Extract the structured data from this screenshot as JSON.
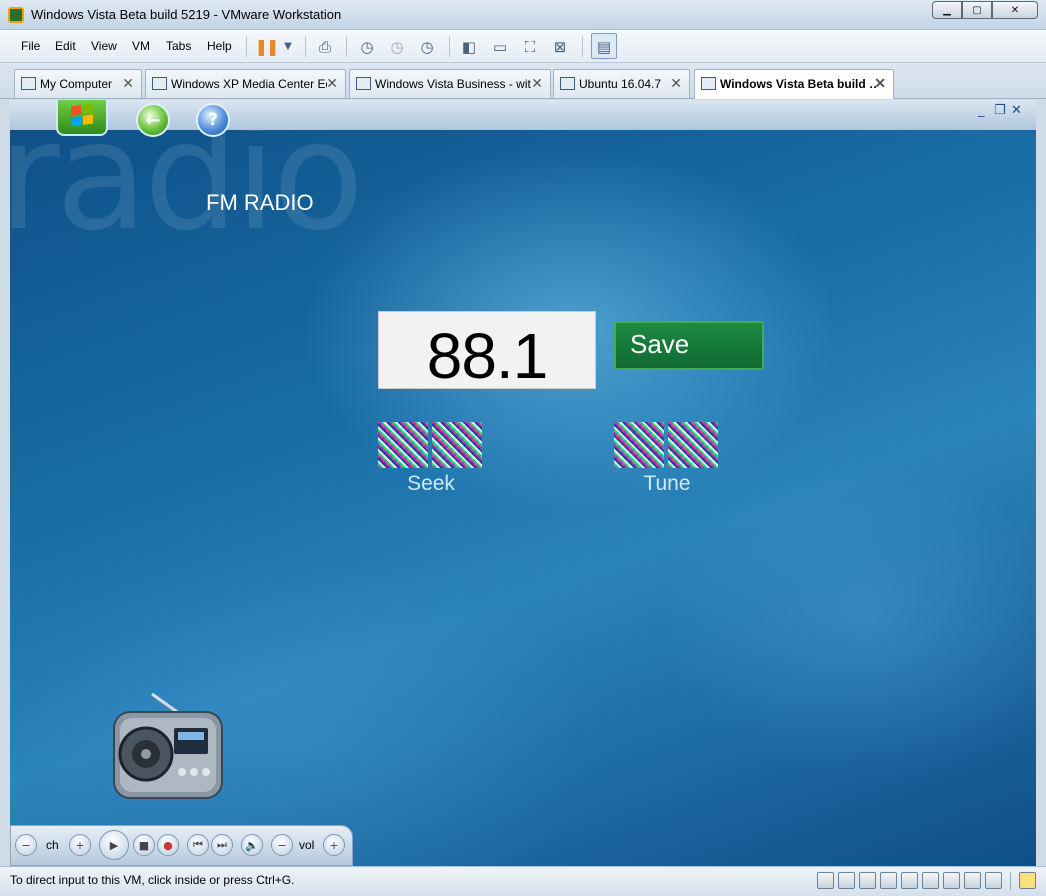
{
  "window": {
    "title": "Windows Vista Beta build 5219 - VMware Workstation"
  },
  "menu": {
    "file": "File",
    "edit": "Edit",
    "view": "View",
    "vm": "VM",
    "tabs": "Tabs",
    "help": "Help"
  },
  "tabs": [
    {
      "label": "My Computer",
      "active": false
    },
    {
      "label": "Windows XP Media Center Edi…",
      "active": false
    },
    {
      "label": "Windows Vista Business - with…",
      "active": false
    },
    {
      "label": "Ubuntu 16.04.7",
      "active": false
    },
    {
      "label": "Windows Vista Beta build …",
      "active": true
    }
  ],
  "media_center": {
    "watermark": "radio",
    "heading": "FM RADIO",
    "frequency": "88.1",
    "save_label": "Save",
    "seek_label": "Seek",
    "tune_label": "Tune",
    "transport": {
      "channel": "ch",
      "volume": "vol"
    }
  },
  "status": {
    "message": "To direct input to this VM, click inside or press Ctrl+G."
  },
  "colors": {
    "accent_green": "#1d8a43",
    "background_blue": "#1a6fa8",
    "pause_orange": "#e8872a"
  },
  "icons": {
    "start": "windows-orb-icon",
    "back": "back-arrow-icon",
    "help": "help-icon",
    "radio": "radio-icon",
    "pause": "pause-icon"
  }
}
